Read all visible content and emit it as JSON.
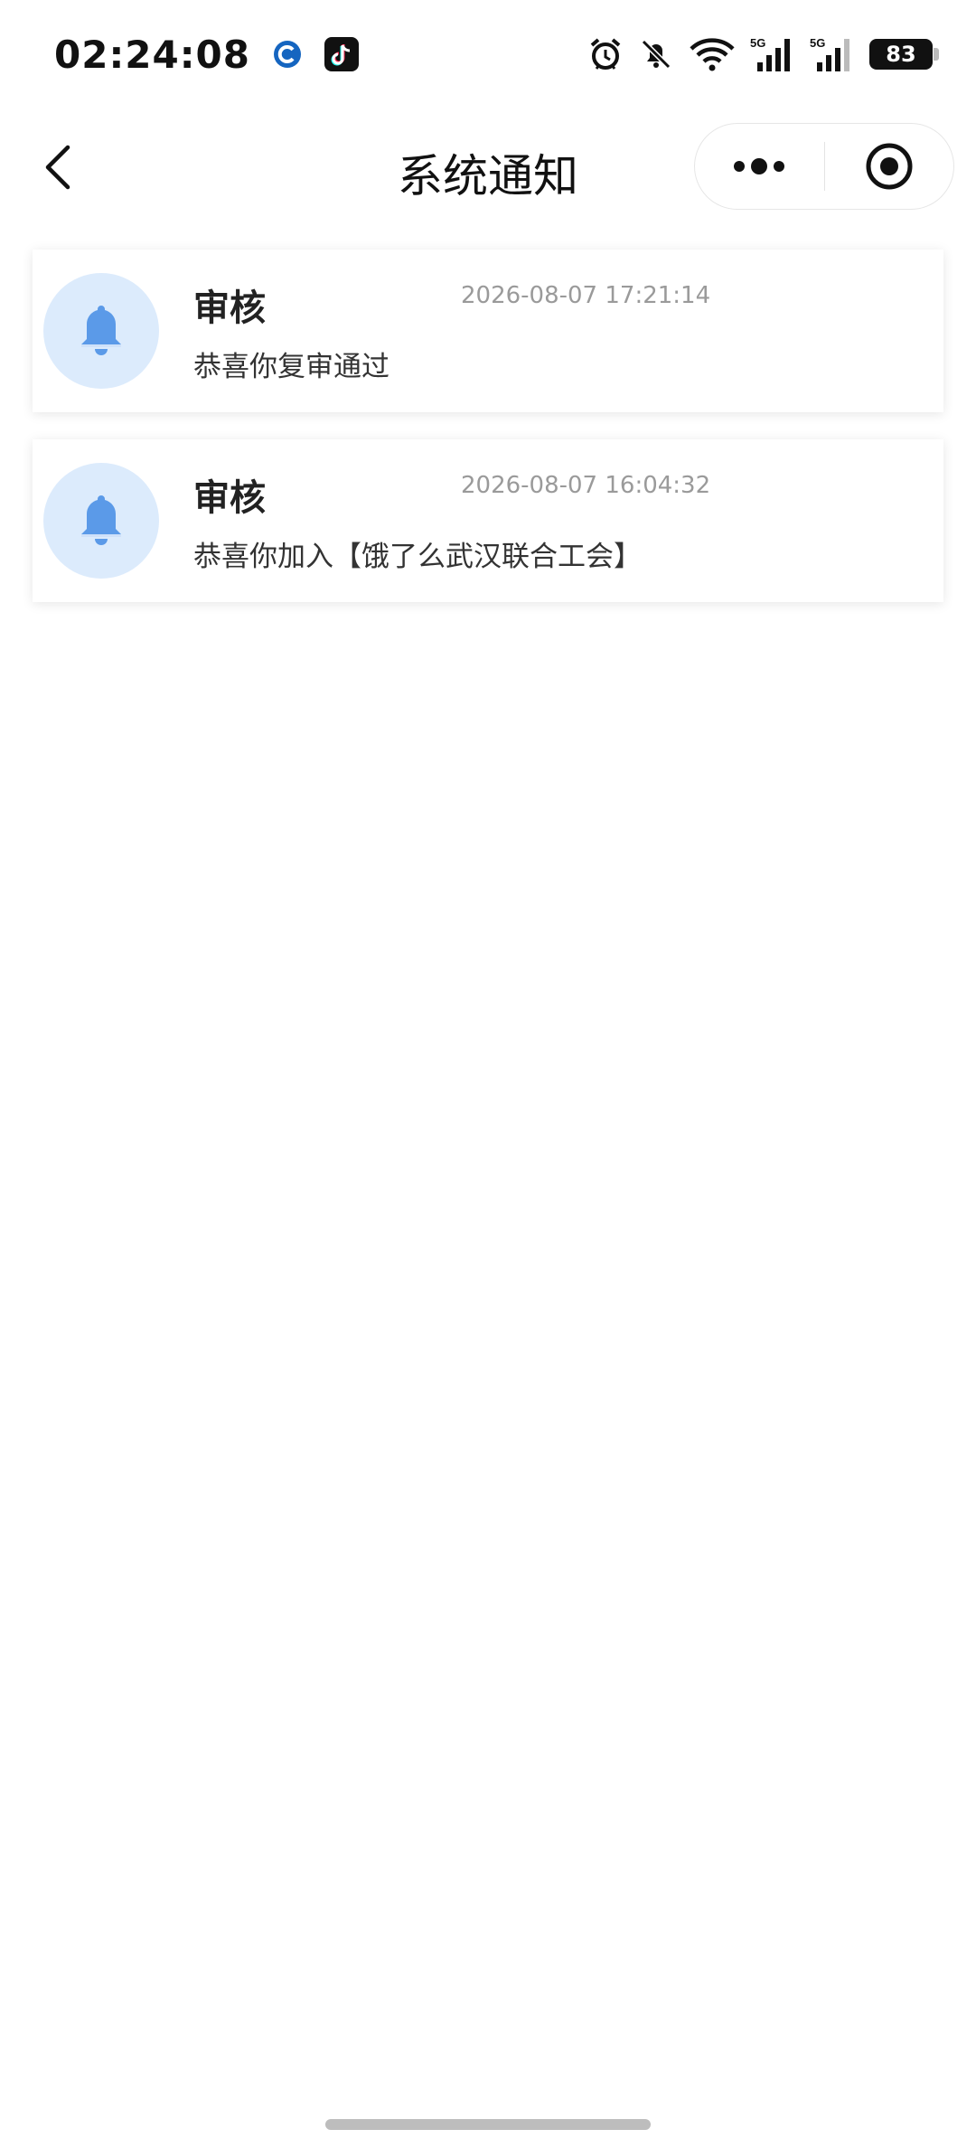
{
  "status_bar": {
    "time": "02:24:08",
    "battery_level": "83",
    "signal_label_1": "5G",
    "signal_label_2": "5G",
    "icons": [
      "app-logo-icon",
      "tiktok-icon",
      "alarm-icon",
      "bell-muted-icon",
      "wifi-icon",
      "signal-5g-icon",
      "signal-5g-icon",
      "battery-icon"
    ]
  },
  "nav": {
    "title": "系统通知",
    "back_icon": "chevron-left-icon",
    "more_icon": "more-dots-icon",
    "close_icon": "target-circle-icon"
  },
  "notices": [
    {
      "title": "审核",
      "time": "2026-08-07 17:21:14",
      "content": "恭喜你复审通过",
      "icon": "bell-icon"
    },
    {
      "title": "审核",
      "time": "2026-08-07 16:04:32",
      "content": "恭喜你加入【饿了么武汉联合工会】",
      "icon": "bell-icon"
    }
  ],
  "colors": {
    "bell_bg": "#dcebfc",
    "bell": "#5b9ae8",
    "time_text": "#9a9a9a"
  }
}
